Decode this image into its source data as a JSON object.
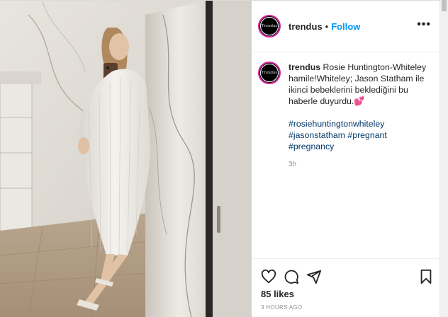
{
  "post": {
    "author": "trendus",
    "avatar_text": "Trendus",
    "follow_label": "Follow",
    "separator": "•",
    "more_label": "•••",
    "caption_text": "Rosie Huntington-Whiteley hamile!⁣⁣Whiteley; Jason Statham ile ikinci bebeklerini beklediğini bu haberle duyurdu.💕",
    "hashtags": [
      "#rosiehuntingtonwhiteley",
      "#jasonstatham",
      "#pregnant",
      "#pregnancy"
    ],
    "relative_time": "3h",
    "likes": "85 likes",
    "timestamp": "3 HOURS AGO"
  },
  "icons": {
    "like": "heart-icon",
    "comment": "comment-icon",
    "share": "share-icon",
    "save": "bookmark-icon",
    "more": "more-options-icon"
  },
  "colors": {
    "link": "#0095f6",
    "hashtag": "#00376b",
    "muted": "#8e8e8e",
    "text": "#262626"
  }
}
